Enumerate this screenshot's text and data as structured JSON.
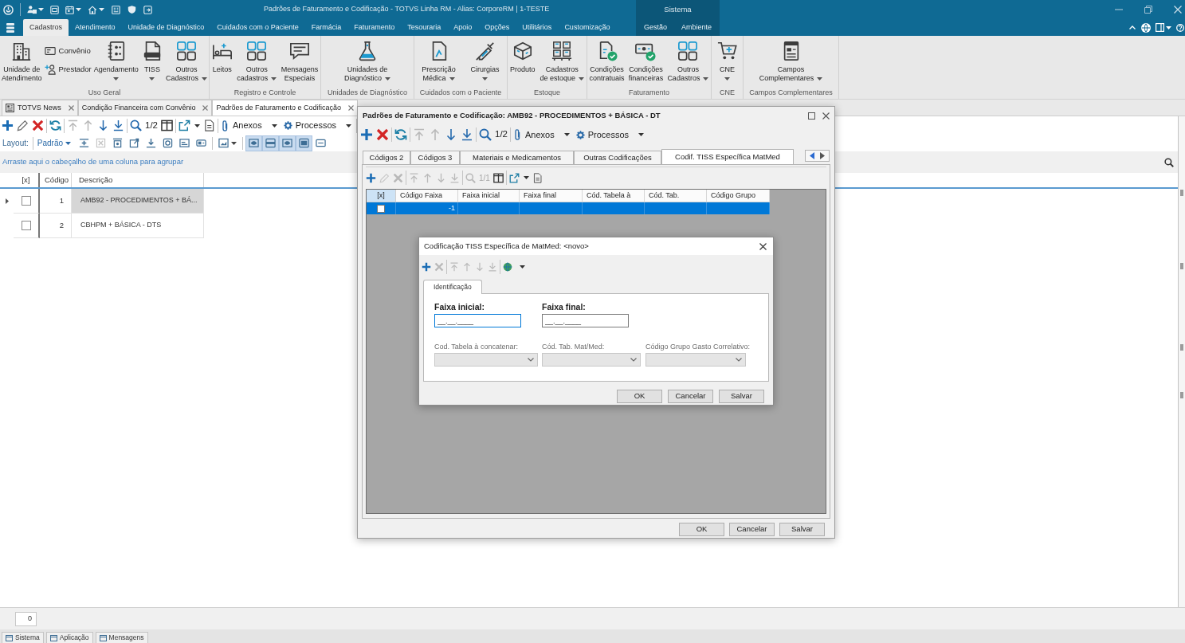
{
  "title_bar": {
    "title": "Padrões de Faturamento e Codificação - TOTVS Linha RM - Alias: CorporeRM | 1-TESTE"
  },
  "ribbon_tabs": [
    {
      "label": "Cadastros",
      "selected": true
    },
    {
      "label": "Atendimento",
      "selected": false
    },
    {
      "label": "Unidade de Diagnóstico",
      "selected": false
    },
    {
      "label": "Cuidados com o Paciente",
      "selected": false
    },
    {
      "label": "Farmácia",
      "selected": false
    },
    {
      "label": "Faturamento",
      "selected": false
    },
    {
      "label": "Tesouraria",
      "selected": false
    },
    {
      "label": "Apoio",
      "selected": false
    },
    {
      "label": "Opções",
      "selected": false
    },
    {
      "label": "Utilitários",
      "selected": false
    },
    {
      "label": "Customização",
      "selected": false
    }
  ],
  "context_tabs": {
    "label": "Sistema",
    "tabs": [
      {
        "label": "Gestão",
        "selected": false
      },
      {
        "label": "Ambiente",
        "selected": false
      }
    ]
  },
  "ribbon_groups": [
    {
      "label": "Uso Geral",
      "items": [
        {
          "kind": "large",
          "label": "Unidade de\nAtendimento",
          "dropdown": false
        },
        {
          "kind": "small",
          "label": "Convênio",
          "dropdown": false
        },
        {
          "kind": "small",
          "label": "Prestador",
          "dropdown": false
        },
        {
          "kind": "large",
          "label": "Agendamento",
          "dropdown": true
        },
        {
          "kind": "large",
          "label": "TISS",
          "dropdown": true
        },
        {
          "kind": "large",
          "label": "Outros\nCadastros",
          "dropdown": true
        }
      ]
    },
    {
      "label": "Registro e Controle",
      "items": [
        {
          "kind": "large",
          "label": "Leitos",
          "dropdown": false
        },
        {
          "kind": "large",
          "label": "Outros\ncadastros",
          "dropdown": true
        },
        {
          "kind": "large",
          "label": "Mensagens\nEspeciais",
          "dropdown": false
        }
      ]
    },
    {
      "label": "Unidades de Diagnóstico",
      "items": [
        {
          "kind": "large",
          "label": "Unidades de\nDiagnóstico",
          "dropdown": true
        }
      ]
    },
    {
      "label": "Cuidados com o Paciente",
      "items": [
        {
          "kind": "large",
          "label": "Prescrição\nMédica",
          "dropdown": true
        },
        {
          "kind": "large",
          "label": "Cirurgias",
          "dropdown": true
        }
      ]
    },
    {
      "label": "Estoque",
      "items": [
        {
          "kind": "large",
          "label": "Produto",
          "dropdown": false
        },
        {
          "kind": "large",
          "label": "Cadastros\nde estoque",
          "dropdown": true
        }
      ]
    },
    {
      "label": "Faturamento",
      "items": [
        {
          "kind": "large",
          "label": "Condições\ncontratuais",
          "dropdown": false
        },
        {
          "kind": "large",
          "label": "Condições\nfinanceiras",
          "dropdown": false
        },
        {
          "kind": "large",
          "label": "Outros\nCadastros",
          "dropdown": true
        }
      ]
    },
    {
      "label": "CNE",
      "items": [
        {
          "kind": "large",
          "label": "CNE",
          "dropdown": true
        }
      ]
    },
    {
      "label": "Campos Complementares",
      "items": [
        {
          "kind": "large",
          "label": "Campos\nComplementares",
          "dropdown": true
        }
      ]
    }
  ],
  "document_tabs": [
    {
      "kind": "news",
      "label": "TOTVS News",
      "selected": false
    },
    {
      "kind": "form",
      "label": "Condição Financeira com Convênio",
      "selected": false
    },
    {
      "kind": "form",
      "label": "Padrões de Faturamento e Codificação",
      "selected": true
    }
  ],
  "main_toolbar": {
    "groups": [
      [
        {
          "kind": "add",
          "disabled": false
        },
        {
          "kind": "edit",
          "disabled": false
        },
        {
          "kind": "delete",
          "disabled": false
        }
      ],
      [
        {
          "kind": "refresh",
          "disabled": false
        }
      ],
      [
        {
          "kind": "first",
          "disabled": true
        },
        {
          "kind": "previous",
          "disabled": true
        },
        {
          "kind": "next",
          "disabled": false
        },
        {
          "kind": "last",
          "disabled": false
        }
      ],
      [
        {
          "kind": "search",
          "disabled": false
        },
        {
          "kind": "counter",
          "text": "1/2",
          "disabled": false
        },
        {
          "kind": "columns",
          "disabled": false
        }
      ],
      [
        {
          "kind": "export",
          "disabled": false
        },
        {
          "kind": "document",
          "disabled": false
        }
      ],
      [
        {
          "kind": "attach_menu",
          "label": "Anexos",
          "disabled": false
        },
        {
          "kind": "process_menu",
          "label": "Processos",
          "disabled": false
        }
      ]
    ]
  },
  "layout_bar": {
    "label": "Layout:",
    "preset": "Padrão",
    "groups": [
      [
        {
          "kind": "button",
          "pressed": false,
          "disabled": false
        },
        {
          "kind": "button",
          "pressed": false,
          "disabled": true
        },
        {
          "kind": "button",
          "pressed": false,
          "disabled": false
        },
        {
          "kind": "button",
          "pressed": false,
          "disabled": false
        },
        {
          "kind": "button",
          "pressed": false,
          "disabled": false
        },
        {
          "kind": "button",
          "pressed": false,
          "disabled": false
        },
        {
          "kind": "button",
          "pressed": false,
          "disabled": false
        },
        {
          "kind": "button",
          "pressed": false,
          "disabled": false
        }
      ],
      [
        {
          "kind": "dropdown",
          "pressed": false,
          "disabled": false
        }
      ],
      [
        {
          "kind": "button",
          "pressed": true,
          "disabled": false
        },
        {
          "kind": "button",
          "pressed": true,
          "disabled": false
        },
        {
          "kind": "button",
          "pressed": true,
          "disabled": false
        },
        {
          "kind": "button",
          "pressed": true,
          "disabled": false
        },
        {
          "kind": "button",
          "pressed": false,
          "disabled": false
        }
      ]
    ]
  },
  "group_panel": {
    "hint": "Arraste aqui o cabeçalho de uma coluna para agrupar"
  },
  "main_grid": {
    "columns": [
      "[x]",
      "Código",
      "Descrição"
    ],
    "rows": [
      {
        "selected": true,
        "checked": false,
        "code": "1",
        "description": "AMB92 - PROCEDIMENTOS + BÁ..."
      },
      {
        "selected": false,
        "checked": false,
        "code": "2",
        "description": "CBHPM + BÁSICA - DTS"
      }
    ]
  },
  "footer": {
    "record_count": "0"
  },
  "bottom_tabs": [
    {
      "label": "Sistema"
    },
    {
      "label": "Aplicação"
    },
    {
      "label": "Mensagens"
    }
  ],
  "record_dialog": {
    "title": "Padrões de Faturamento e Codificação: AMB92 - PROCEDIMENTOS + BÁSICA - DT",
    "toolbar": {
      "groups": [
        [
          {
            "kind": "add",
            "disabled": false
          },
          {
            "kind": "delete",
            "disabled": false
          }
        ],
        [
          {
            "kind": "refresh",
            "disabled": false
          }
        ],
        [
          {
            "kind": "first",
            "disabled": true
          },
          {
            "kind": "previous",
            "disabled": true
          },
          {
            "kind": "next",
            "disabled": false
          },
          {
            "kind": "last",
            "disabled": false
          }
        ],
        [
          {
            "kind": "search",
            "disabled": false
          },
          {
            "kind": "counter",
            "text": "1/2",
            "disabled": false
          }
        ],
        [
          {
            "kind": "attach_menu",
            "label": "Anexos",
            "disabled": false
          },
          {
            "kind": "process_menu",
            "label": "Processos",
            "disabled": false
          }
        ]
      ]
    },
    "tabs": [
      {
        "label": "Códigos 2",
        "selected": false
      },
      {
        "label": "Códigos 3",
        "selected": false
      },
      {
        "label": "Materiais e Medicamentos",
        "selected": false
      },
      {
        "label": "Outras Codificações",
        "selected": false
      },
      {
        "label": "Codif. TISS Específica MatMed",
        "selected": true
      }
    ],
    "sub_toolbar": {
      "groups": [
        [
          {
            "kind": "add",
            "disabled": false
          },
          {
            "kind": "edit",
            "disabled": true
          },
          {
            "kind": "delete",
            "disabled": true
          }
        ],
        [
          {
            "kind": "first",
            "disabled": true
          },
          {
            "kind": "previous",
            "disabled": true
          },
          {
            "kind": "next",
            "disabled": true
          },
          {
            "kind": "last",
            "disabled": true
          }
        ],
        [
          {
            "kind": "search",
            "disabled": true
          },
          {
            "kind": "counter",
            "text": "1/1",
            "disabled": true
          },
          {
            "kind": "columns",
            "disabled": false
          }
        ],
        [
          {
            "kind": "export",
            "disabled": false
          },
          {
            "kind": "document",
            "disabled": false
          }
        ]
      ]
    },
    "grid": {
      "columns": [
        "[x]",
        "Código Faixa",
        "Faixa inicial",
        "Faixa final",
        "Cód. Tabela à",
        "Cód. Tab.",
        "Código Grupo"
      ],
      "rows": [
        {
          "selected": true,
          "checked": false,
          "code": "-1"
        }
      ]
    },
    "buttons": [
      "OK",
      "Cancelar",
      "Salvar"
    ]
  },
  "detail_dialog": {
    "title": "Codificação TISS Específica de MatMed: <novo>",
    "toolbar": {
      "groups": [
        [
          {
            "kind": "add",
            "disabled": false
          },
          {
            "kind": "delete",
            "disabled": true
          }
        ],
        [
          {
            "kind": "first",
            "disabled": true
          },
          {
            "kind": "previous",
            "disabled": true
          },
          {
            "kind": "next",
            "disabled": true
          },
          {
            "kind": "last",
            "disabled": true
          }
        ],
        [
          {
            "kind": "globe_menu",
            "disabled": false
          }
        ]
      ]
    },
    "tabs": [
      {
        "label": "Identificação",
        "selected": true
      }
    ],
    "fields": [
      {
        "kind": "text",
        "label": "Faixa inicial:",
        "value": "__.__.____",
        "required": true,
        "focused": true,
        "disabled": false
      },
      {
        "kind": "text",
        "label": "Faixa final:",
        "value": "__.__.____",
        "required": true,
        "focused": false,
        "disabled": false
      },
      {
        "kind": "select",
        "label": "Cod. Tabela à concatenar:",
        "required": false,
        "focused": false,
        "disabled": true
      },
      {
        "kind": "select",
        "label": "Cód. Tab. Mat/Med:",
        "required": false,
        "focused": false,
        "disabled": true
      },
      {
        "kind": "select",
        "label": "Código Grupo Gasto Correlativo:",
        "required": false,
        "focused": false,
        "disabled": true
      }
    ],
    "buttons": [
      "OK",
      "Cancelar",
      "Salvar"
    ]
  }
}
